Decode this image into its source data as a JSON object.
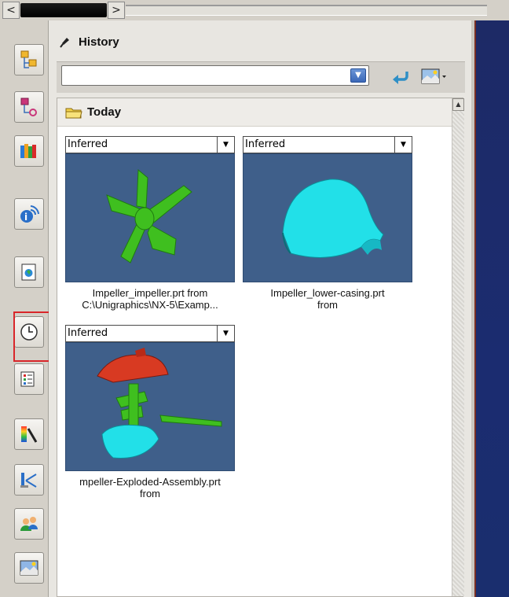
{
  "panel": {
    "title": "History",
    "search": {
      "value": "",
      "placeholder": ""
    },
    "group": {
      "label": "Today"
    }
  },
  "items": [
    {
      "filter": "Inferred",
      "caption_line1": "Impeller_impeller.prt from",
      "caption_line2": "C:\\Unigraphics\\NX-5\\Examp...",
      "caption_line3": ""
    },
    {
      "filter": "Inferred",
      "caption_line1": "Impeller_lower-casing.prt",
      "caption_line2": "from",
      "caption_line3": ""
    },
    {
      "filter": "Inferred",
      "caption_line1": "mpeller-Exploded-Assembly.prt",
      "caption_line2": "from",
      "caption_line3": ""
    }
  ],
  "colors": {
    "highlight": "#d9262a",
    "thumb_bg": "#3f5f8a",
    "part_green": "#3fbf1f",
    "part_cyan": "#22e0e8",
    "part_red": "#d83a22"
  },
  "icons": [
    "assembly-navigator-icon",
    "constraint-navigator-icon",
    "part-navigator-icon",
    "reuse-library-icon",
    "hd3d-tools-icon",
    "web-browser-icon",
    "history-icon",
    "process-studio-icon",
    "manufacturing-wizard-icon",
    "system-materials-icon",
    "roles-icon",
    "system-scenes-icon"
  ]
}
